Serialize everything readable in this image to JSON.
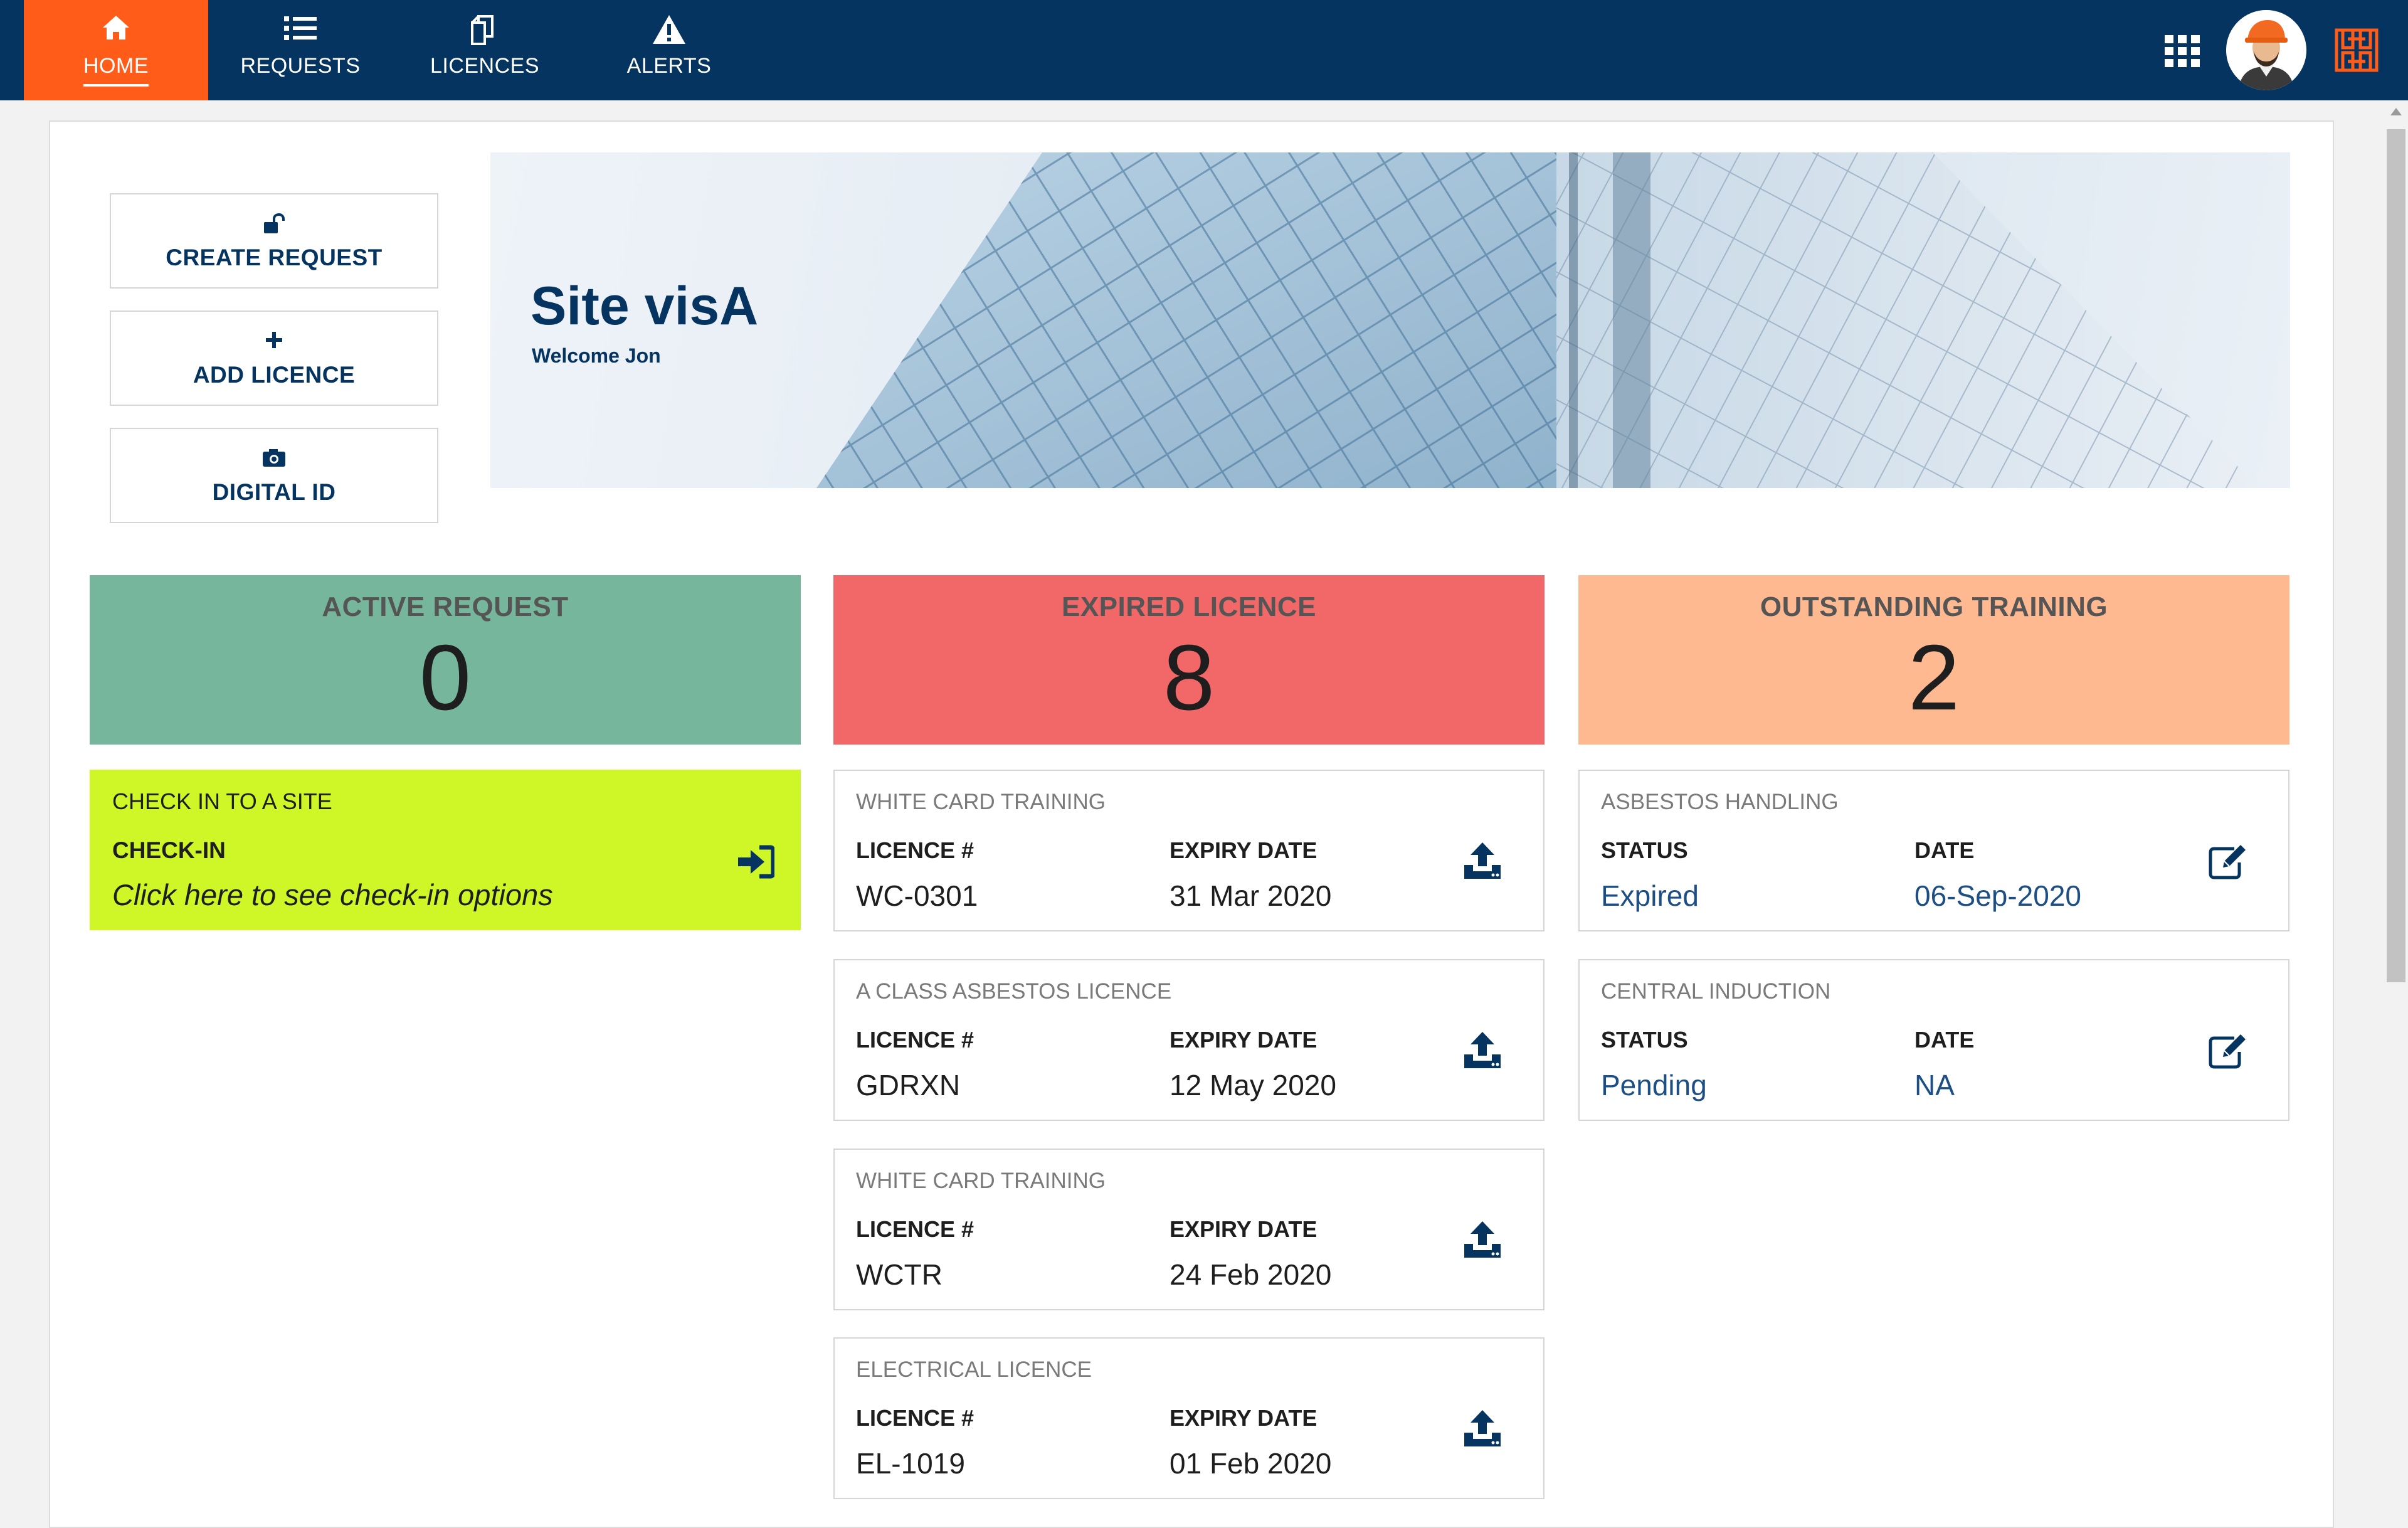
{
  "nav": {
    "items": [
      {
        "label": "HOME",
        "icon": "home-icon",
        "active": true
      },
      {
        "label": "REQUESTS",
        "icon": "list-icon",
        "active": false
      },
      {
        "label": "LICENCES",
        "icon": "licences-icon",
        "active": false
      },
      {
        "label": "ALERTS",
        "icon": "warning-icon",
        "active": false
      }
    ],
    "right_icons": [
      "apps-grid-icon",
      "user-avatar",
      "brand-logo"
    ]
  },
  "actions": [
    {
      "label": "CREATE REQUEST",
      "icon": "unlock-icon"
    },
    {
      "label": "ADD LICENCE",
      "icon": "plus-icon"
    },
    {
      "label": "DIGITAL ID",
      "icon": "id-camera-icon"
    }
  ],
  "banner": {
    "title": "Site visA",
    "subtitle": "Welcome Jon"
  },
  "tiles": [
    {
      "label": "ACTIVE REQUEST",
      "count": "0",
      "color": "#76b69c"
    },
    {
      "label": "EXPIRED LICENCE",
      "count": "8",
      "color": "#f26768"
    },
    {
      "label": "OUTSTANDING TRAINING",
      "count": "2",
      "color": "#ffb990"
    }
  ],
  "checkin": {
    "title": "CHECK IN TO A SITE",
    "heading": "CHECK-IN",
    "link": "Click here to see check-in options",
    "icon": "sign-in-icon",
    "color": "#cff727"
  },
  "licences": [
    {
      "title": "WHITE CARD TRAINING",
      "col1_header": "LICENCE #",
      "col2_header": "EXPIRY DATE",
      "licence_no": "WC-0301",
      "expiry": "31 Mar 2020",
      "icon": "upload-icon"
    },
    {
      "title": "A CLASS ASBESTOS LICENCE",
      "col1_header": "LICENCE #",
      "col2_header": "EXPIRY DATE",
      "licence_no": "GDRXN",
      "expiry": "12 May 2020",
      "icon": "upload-icon"
    },
    {
      "title": "WHITE CARD TRAINING",
      "col1_header": "LICENCE #",
      "col2_header": "EXPIRY DATE",
      "licence_no": "WCTR",
      "expiry": "24 Feb 2020",
      "icon": "upload-icon"
    },
    {
      "title": "ELECTRICAL LICENCE",
      "col1_header": "LICENCE #",
      "col2_header": "EXPIRY DATE",
      "licence_no": "EL-1019",
      "expiry": "01 Feb 2020",
      "icon": "upload-icon"
    }
  ],
  "training": [
    {
      "title": "ASBESTOS HANDLING",
      "col1_header": "STATUS",
      "col2_header": "DATE",
      "status": "Expired",
      "date": "06-Sep-2020",
      "icon": "edit-icon"
    },
    {
      "title": "CENTRAL INDUCTION",
      "col1_header": "STATUS",
      "col2_header": "DATE",
      "status": "Pending",
      "date": "NA",
      "icon": "edit-icon"
    }
  ],
  "colors": {
    "navbar": "#053461",
    "active_tab": "#ff5c1a",
    "accent_text": "#053461"
  }
}
